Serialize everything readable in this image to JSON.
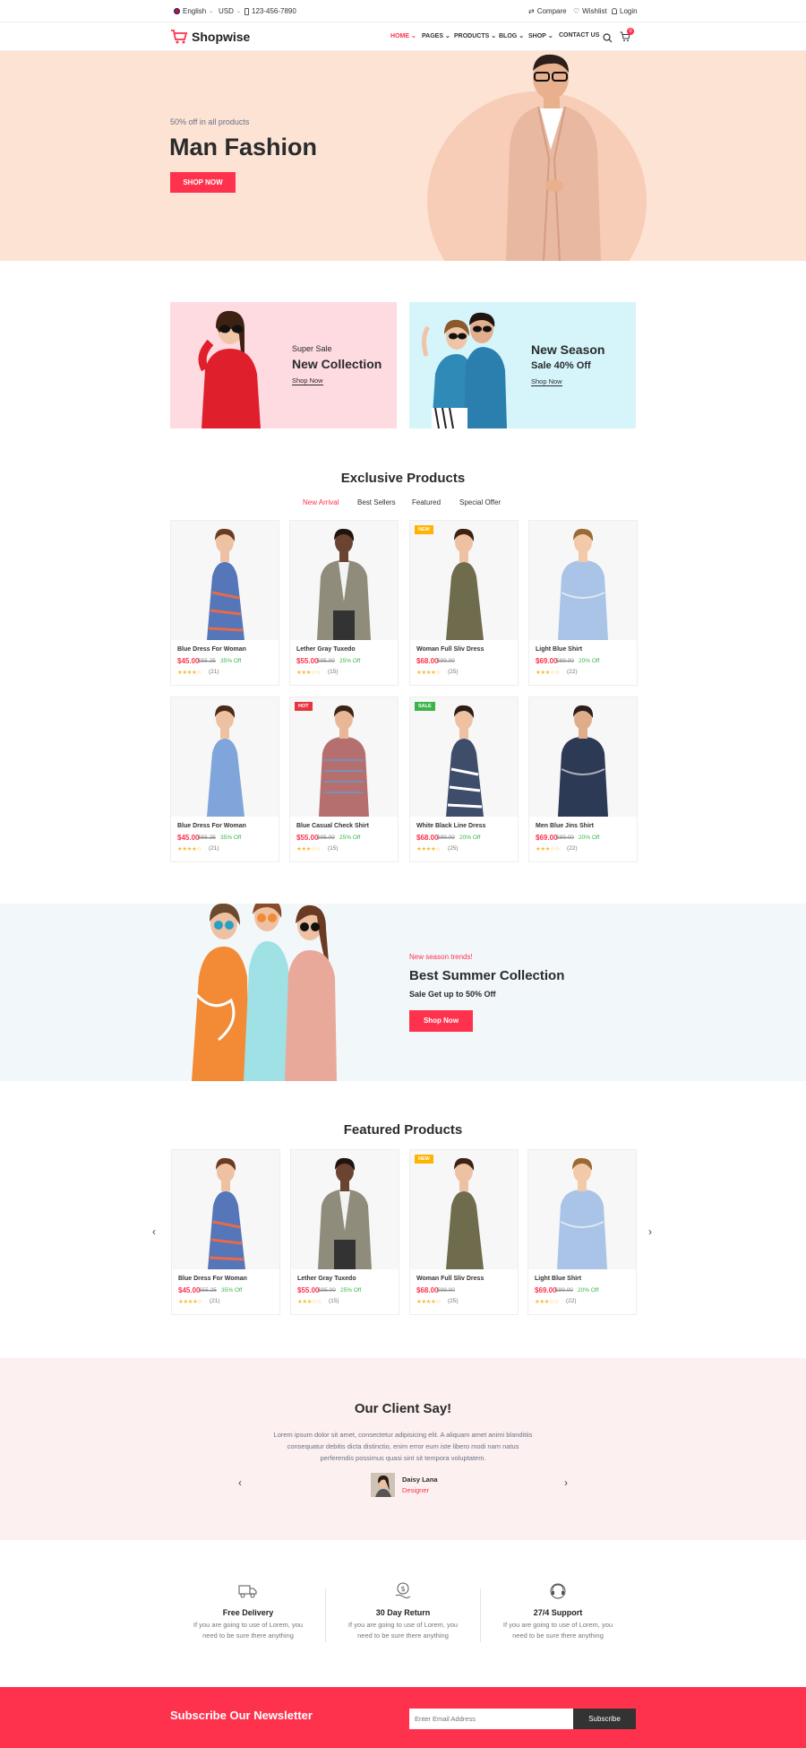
{
  "topbar": {
    "language": "English",
    "currency": "USD",
    "phone": "123-456-7890",
    "compare": "Compare",
    "wishlist": "Wishlist",
    "login": "Login"
  },
  "header": {
    "logo": "Shopwise",
    "nav": [
      "HOME",
      "PAGES",
      "PRODUCTS",
      "BLOG",
      "SHOP",
      "CONTACT US"
    ],
    "cart_count": "0"
  },
  "hero": {
    "subtitle": "50% off in all products",
    "title": "Man Fashion",
    "button": "SHOP NOW"
  },
  "banners": [
    {
      "pre": "Super Sale",
      "title": "New Collection",
      "link": "Shop Now"
    },
    {
      "pre": "New Season",
      "title": "Sale 40% Off",
      "link": "Shop Now"
    }
  ],
  "exclusive": {
    "title": "Exclusive Products",
    "tabs": [
      "New Arrival",
      "Best Sellers",
      "Featured",
      "Special Offer"
    ],
    "products": [
      {
        "name": "Blue Dress For Woman",
        "price": "$45.00",
        "old": "$55.25",
        "off": "35% Off",
        "reviews": "(21)",
        "badge": "",
        "rating": 4
      },
      {
        "name": "Lether Gray Tuxedo",
        "price": "$55.00",
        "old": "$95.00",
        "off": "25% Off",
        "reviews": "(15)",
        "badge": "",
        "rating": 3.5
      },
      {
        "name": "Woman Full Sliv Dress",
        "price": "$68.00",
        "old": "$99.00",
        "off": "",
        "reviews": "(25)",
        "badge": "NEW",
        "rating": 4.5
      },
      {
        "name": "Light Blue Shirt",
        "price": "$69.00",
        "old": "$89.00",
        "off": "20% Off",
        "reviews": "(22)",
        "badge": "",
        "rating": 3.5
      },
      {
        "name": "Blue Dress For Woman",
        "price": "$45.00",
        "old": "$55.25",
        "off": "35% Off",
        "reviews": "(21)",
        "badge": "",
        "rating": 4
      },
      {
        "name": "Blue Casual Check Shirt",
        "price": "$55.00",
        "old": "$95.00",
        "off": "25% Off",
        "reviews": "(15)",
        "badge": "HOT",
        "rating": 3.5
      },
      {
        "name": "White Black Line Dress",
        "price": "$68.00",
        "old": "$99.00",
        "off": "20% Off",
        "reviews": "(25)",
        "badge": "SALE",
        "rating": 4.5
      },
      {
        "name": "Men Blue Jins Shirt",
        "price": "$69.00",
        "old": "$89.00",
        "off": "20% Off",
        "reviews": "(22)",
        "badge": "",
        "rating": 3.5
      }
    ]
  },
  "summer": {
    "pre": "New season trends!",
    "title": "Best Summer Collection",
    "sub": "Sale Get up to 50% Off",
    "button": "Shop Now"
  },
  "featured": {
    "title": "Featured Products",
    "products": [
      {
        "name": "Blue Dress For Woman",
        "price": "$45.00",
        "old": "$55.25",
        "off": "35% Off",
        "reviews": "(21)",
        "badge": "",
        "rating": 4
      },
      {
        "name": "Lether Gray Tuxedo",
        "price": "$55.00",
        "old": "$95.00",
        "off": "25% Off",
        "reviews": "(15)",
        "badge": "",
        "rating": 3.5
      },
      {
        "name": "Woman Full Sliv Dress",
        "price": "$68.00",
        "old": "$99.00",
        "off": "",
        "reviews": "(25)",
        "badge": "NEW",
        "rating": 4.5
      },
      {
        "name": "Light Blue Shirt",
        "price": "$69.00",
        "old": "$89.00",
        "off": "20% Off",
        "reviews": "(22)",
        "badge": "",
        "rating": 3.5
      }
    ]
  },
  "testimonial": {
    "title": "Our Client Say!",
    "text": [
      "Lorem ipsum dolor sit amet, consectetur adipisicing elit. A aliquam amet animi blanditiis",
      "consequatur debitis dicta distinctio, enim error eum iste libero modi nam natus",
      "perferendis possimus quasi sint sit tempora voluptatem."
    ],
    "name": "Daisy Lana",
    "role": "Designer"
  },
  "features": [
    {
      "title": "Free Delivery",
      "desc": [
        "If you are going to use of Lorem, you",
        "need to be sure there anything"
      ]
    },
    {
      "title": "30 Day Return",
      "desc": [
        "If you are going to use of Lorem, you",
        "need to be sure there anything"
      ]
    },
    {
      "title": "27/4 Support",
      "desc": [
        "If you are going to use of Lorem, you",
        "need to be sure there anything"
      ]
    }
  ],
  "newsletter": {
    "title": "Subscribe Our Newsletter",
    "placeholder": "Enter Email Address",
    "button": "Subscribe"
  },
  "colors": {
    "accent": "#ff324d",
    "hero_bg": "#fde3d4",
    "banner1_bg": "#fedbe1",
    "banner2_bg": "#d5f5fb",
    "summer_bg": "#f2f7fa",
    "testimonial_bg": "#fdf0f0"
  }
}
